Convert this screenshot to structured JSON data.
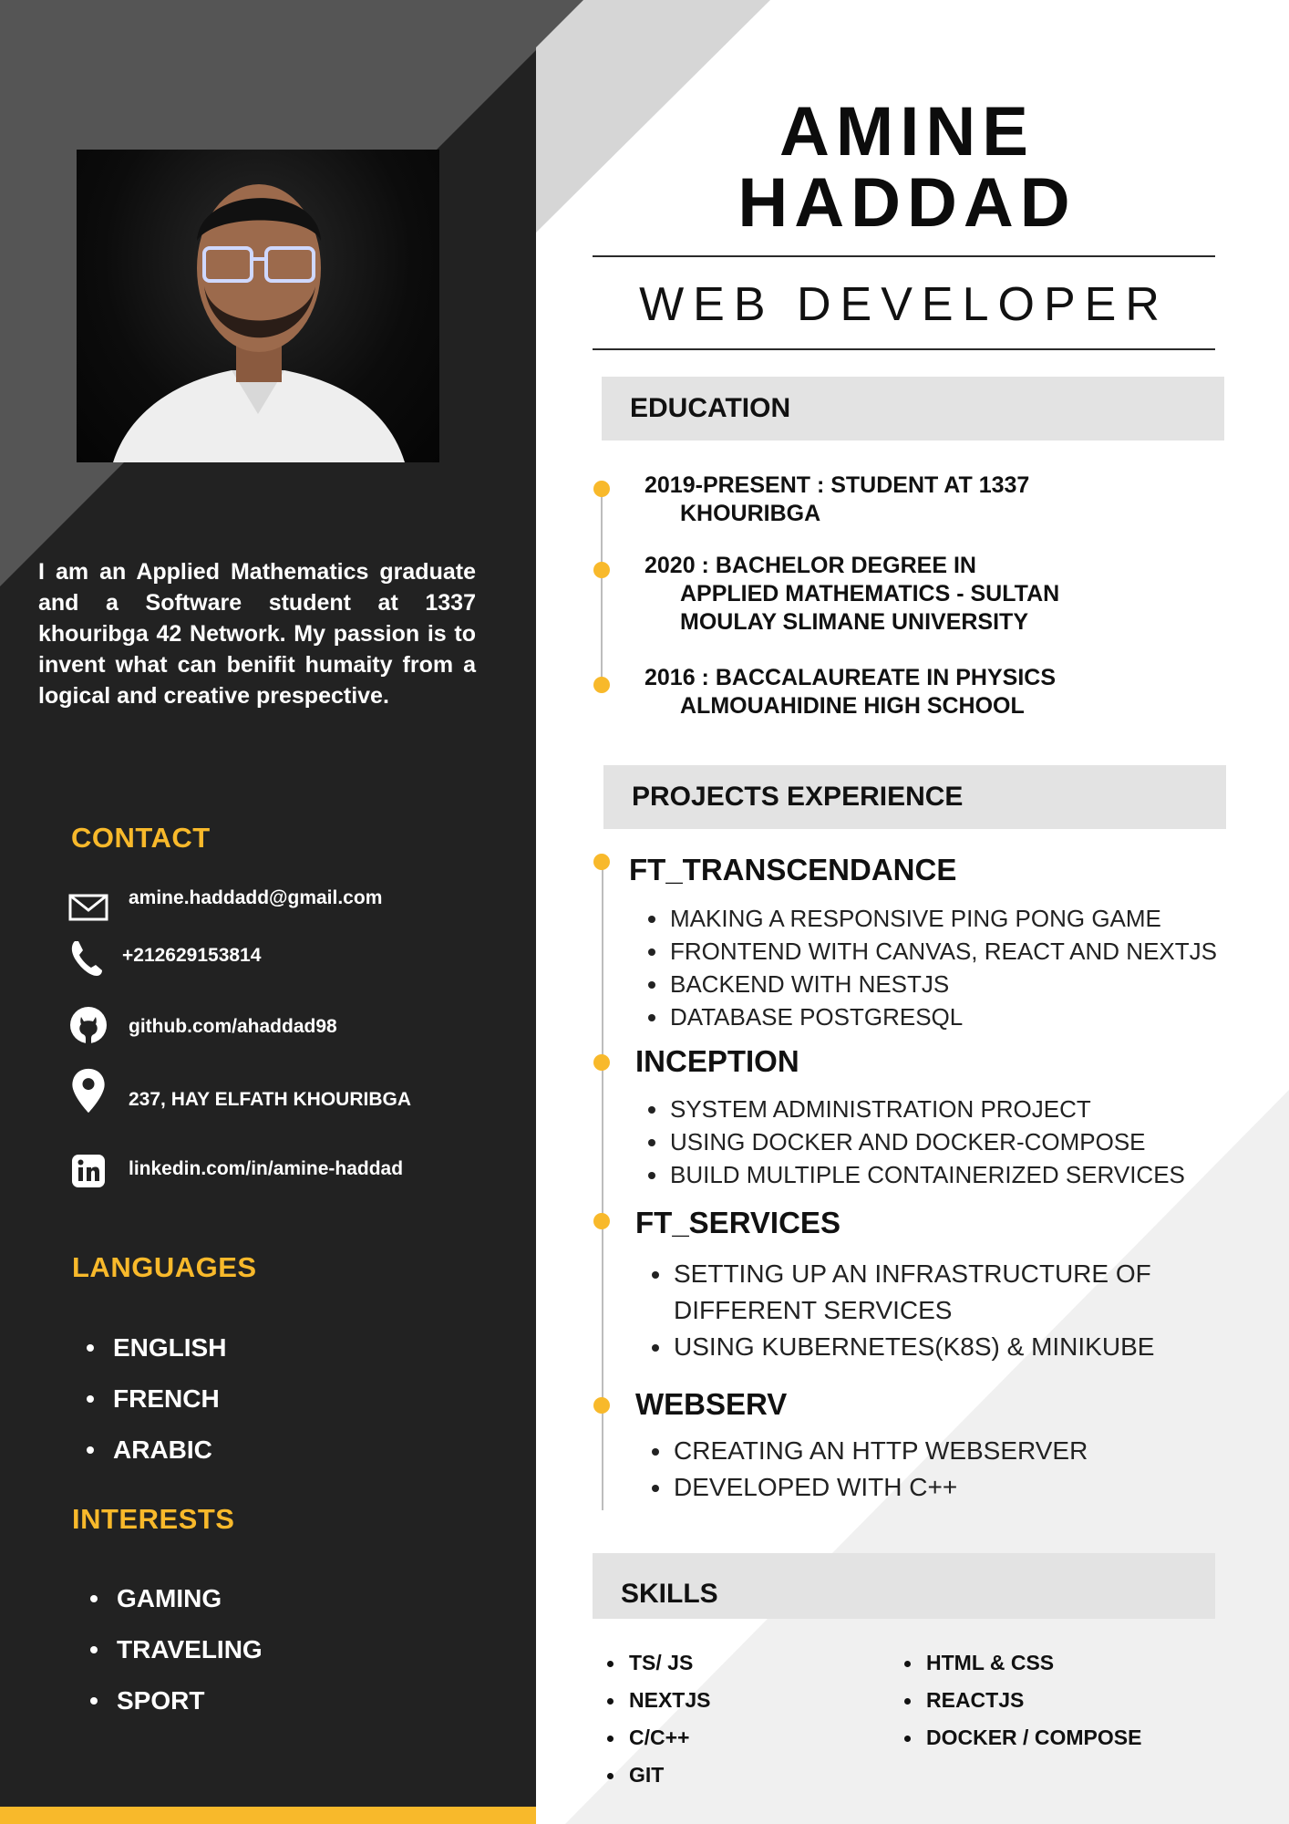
{
  "profile": {
    "first_name": "AMINE",
    "last_name": "HADDAD",
    "job_title": "WEB DEVELOPER",
    "about": "I am an Applied Mathematics graduate and a Software student at 1337 khouribga 42 Network. My passion is to invent what can benifit humaity from a logical and creative prespective."
  },
  "contact": {
    "heading": "CONTACT",
    "items": [
      {
        "icon": "mail-icon",
        "text": "amine.haddadd@gmail.com"
      },
      {
        "icon": "phone-icon",
        "text": "+212629153814"
      },
      {
        "icon": "github-icon",
        "text": "github.com/ahaddad98"
      },
      {
        "icon": "location-pin-icon",
        "text": "237, HAY ELFATH KHOURIBGA"
      },
      {
        "icon": "linkedin-icon",
        "text": "linkedin.com/in/amine-haddad"
      }
    ]
  },
  "languages": {
    "heading": "LANGUAGES",
    "items": [
      "ENGLISH",
      "FRENCH",
      "ARABIC"
    ]
  },
  "interests": {
    "heading": "INTERESTS",
    "items": [
      "GAMING",
      "TRAVELING",
      "SPORT"
    ]
  },
  "education": {
    "heading": "EDUCATION",
    "entries": [
      {
        "line1": "2019-PRESENT  : STUDENT AT  1337",
        "lines": [
          "KHOURIBGA"
        ]
      },
      {
        "line1": "2020   : BACHELOR DEGREE IN",
        "lines": [
          "APPLIED MATHEMATICS - SULTAN",
          "MOULAY SLIMANE UNIVERSITY"
        ]
      },
      {
        "line1": "2016   : BACCALAUREATE IN PHYSICS",
        "lines": [
          "ALMOUAHIDINE HIGH SCHOOL"
        ]
      }
    ]
  },
  "projects": {
    "heading": "PROJECTS EXPERIENCE",
    "items": [
      {
        "title": "FT_TRANSCENDANCE",
        "bullets": [
          "MAKING A RESPONSIVE PING PONG GAME",
          "FRONTEND WITH CANVAS, REACT AND NEXTJS",
          "BACKEND WITH NESTJS",
          "DATABASE POSTGRESQL"
        ]
      },
      {
        "title": "INCEPTION",
        "bullets": [
          "SYSTEM ADMINISTRATION PROJECT",
          "USING DOCKER  AND DOCKER-COMPOSE",
          "BUILD MULTIPLE CONTAINERIZED SERVICES"
        ]
      },
      {
        "title": "FT_SERVICES",
        "bullets": [
          "SETTING UP AN INFRASTRUCTURE OF",
          "DIFFERENT SERVICES",
          "USING KUBERNETES(K8S) & MINIKUBE"
        ]
      },
      {
        "title": "WEBSERV",
        "bullets": [
          "CREATING AN HTTP WEBSERVER",
          "DEVELOPED WITH C++"
        ]
      }
    ]
  },
  "skills": {
    "heading": "SKILLS",
    "col1": [
      "TS/ JS",
      "NEXTJS",
      "C/C++",
      "GIT"
    ],
    "col2": [
      "HTML & CSS",
      "REACTJS",
      "DOCKER / COMPOSE"
    ]
  },
  "colors": {
    "accent": "#f8b92b",
    "sidebar": "#222222",
    "sidebar_top": "#555555",
    "bar": "#e3e3e3"
  }
}
